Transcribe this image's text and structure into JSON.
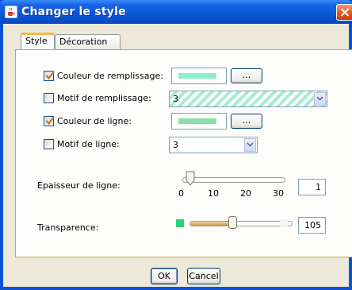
{
  "window": {
    "title": "Changer le style"
  },
  "tabs": [
    {
      "label": "Style",
      "selected": true
    },
    {
      "label": "Décoration",
      "selected": false
    }
  ],
  "fill_color": {
    "label": "Couleur de remplissage:",
    "checked": true,
    "color": "#8ceec6",
    "button": "..."
  },
  "fill_pattern": {
    "label": "Motif de remplissage:",
    "checked": false,
    "value": "3",
    "hatch_color": "#a8ecd0"
  },
  "line_color": {
    "label": "Couleur de ligne:",
    "checked": true,
    "color": "#8cdcac",
    "button": "..."
  },
  "line_pattern": {
    "label": "Motif de ligne:",
    "checked": false,
    "value": "3"
  },
  "line_width": {
    "label": "Epaisseur de ligne:",
    "value": "1",
    "min": 0,
    "max": 30,
    "ticks": [
      "0",
      "10",
      "20",
      "30"
    ]
  },
  "transparency": {
    "label": "Transparence:",
    "value": "105",
    "min": 0,
    "max": 255,
    "opaque_color": "#2ecf7a",
    "transparent_color": "#f4f4f4"
  },
  "buttons": {
    "ok": "OK",
    "cancel": "Cancel"
  },
  "colors": {
    "titlebar": "#0b55d8",
    "accent_tab": "#f7b64a",
    "dialog_bg": "#ece9d8"
  }
}
